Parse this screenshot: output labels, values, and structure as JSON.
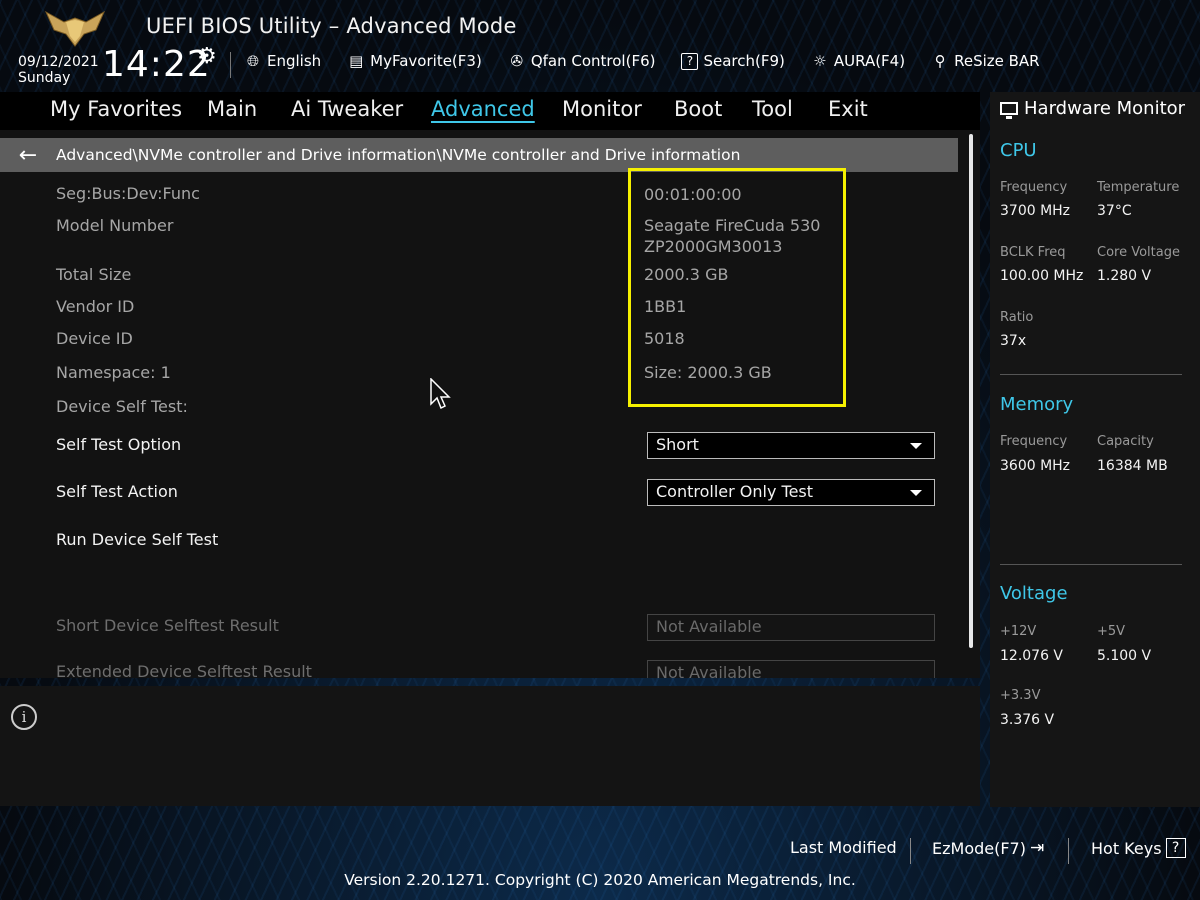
{
  "header": {
    "title": "UEFI BIOS Utility – Advanced Mode",
    "date": "09/12/2021",
    "day": "Sunday",
    "time": "14:22",
    "toolbar": [
      {
        "label": "English",
        "icon": "globe-icon"
      },
      {
        "label": "MyFavorite(F3)",
        "icon": "favorite-icon"
      },
      {
        "label": "Qfan Control(F6)",
        "icon": "fan-icon"
      },
      {
        "label": "Search(F9)",
        "icon": "search-icon"
      },
      {
        "label": "AURA(F4)",
        "icon": "aura-icon"
      },
      {
        "label": "ReSize BAR",
        "icon": "resize-bar-icon"
      }
    ]
  },
  "tabs": [
    "My Favorites",
    "Main",
    "Ai Tweaker",
    "Advanced",
    "Monitor",
    "Boot",
    "Tool",
    "Exit"
  ],
  "active_tab": "Advanced",
  "breadcrumb": "Advanced\\NVMe controller and Drive information\\NVMe controller and Drive information",
  "info": {
    "seg_label": "Seg:Bus:Dev:Func",
    "seg_value": "00:01:00:00",
    "model_label": "Model Number",
    "model_value_1": "Seagate FireCuda 530",
    "model_value_2": "ZP2000GM30013",
    "total_label": "Total Size",
    "total_value": "2000.3 GB",
    "vendor_label": "Vendor ID",
    "vendor_value": "1BB1",
    "device_label": "Device ID",
    "device_value": "5018",
    "namespace_label": "Namespace: 1",
    "namespace_value": "Size: 2000.3 GB",
    "selftest_label": "Device Self Test:"
  },
  "options": {
    "test_option_label": "Self Test Option",
    "test_option_value": "Short",
    "test_action_label": "Self Test Action",
    "test_action_value": "Controller Only Test",
    "run_label": "Run Device Self Test",
    "short_result_label": "Short Device Selftest Result",
    "short_result_value": "Not Available",
    "extended_result_label": "Extended Device Selftest Result",
    "extended_result_value": "Not Available"
  },
  "hw_monitor": {
    "title": "Hardware Monitor",
    "cpu": {
      "heading": "CPU",
      "frequency_label": "Frequency",
      "frequency_value": "3700 MHz",
      "temperature_label": "Temperature",
      "temperature_value": "37°C",
      "bclk_label": "BCLK Freq",
      "bclk_value": "100.00 MHz",
      "core_voltage_label": "Core Voltage",
      "core_voltage_value": "1.280 V",
      "ratio_label": "Ratio",
      "ratio_value": "37x"
    },
    "memory": {
      "heading": "Memory",
      "frequency_label": "Frequency",
      "frequency_value": "3600 MHz",
      "capacity_label": "Capacity",
      "capacity_value": "16384 MB"
    },
    "voltage": {
      "heading": "Voltage",
      "v12_label": "+12V",
      "v12_value": "12.076 V",
      "v5_label": "+5V",
      "v5_value": "5.100 V",
      "v33_label": "+3.3V",
      "v33_value": "3.376 V"
    }
  },
  "footer": {
    "last_modified": "Last Modified",
    "ezmode": "EzMode(F7)",
    "hotkeys": "Hot Keys",
    "hotkeys_icon": "?",
    "version": "Version 2.20.1271. Copyright (C) 2020 American Megatrends, Inc."
  },
  "colors": {
    "accent": "#3fc7e8",
    "highlight": "#f5f000"
  }
}
